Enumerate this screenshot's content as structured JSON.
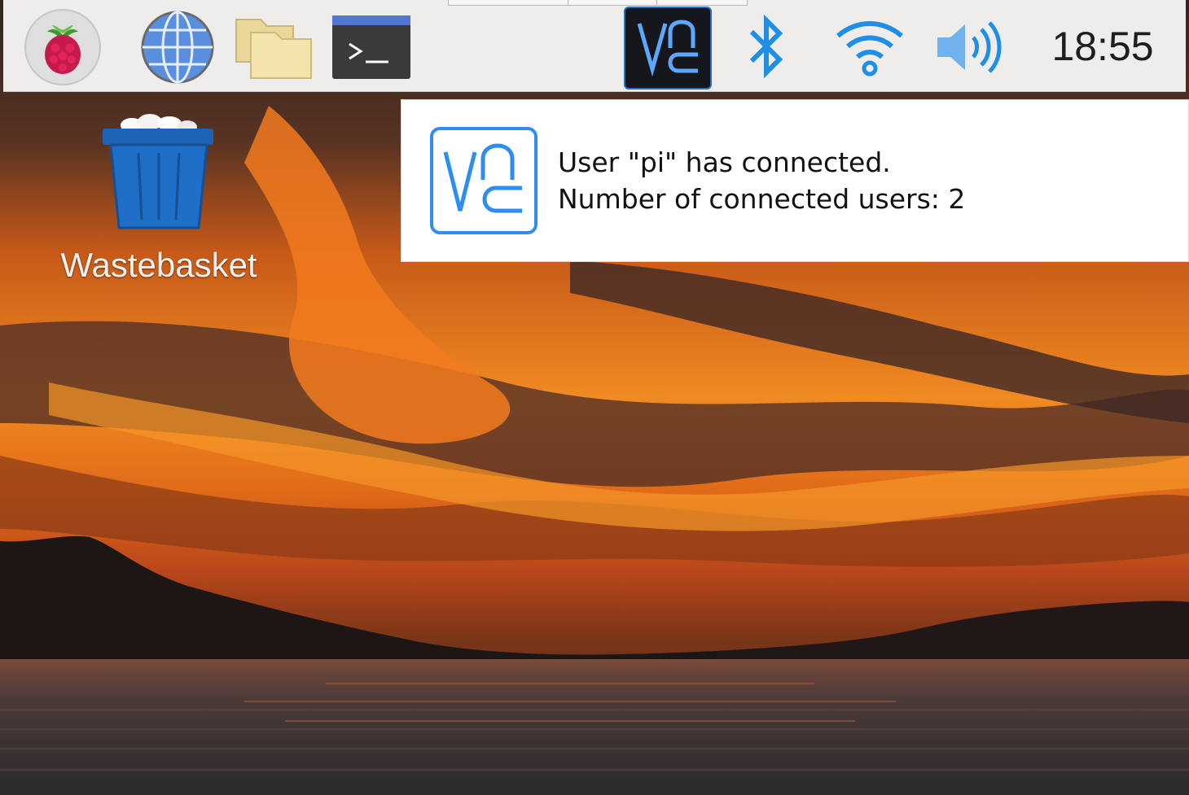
{
  "taskbar": {
    "launchers": [
      {
        "name": "raspberry-pi-menu",
        "icon": "raspberry-icon"
      },
      {
        "name": "web-browser",
        "icon": "globe-icon"
      },
      {
        "name": "file-manager",
        "icon": "folder-icon"
      },
      {
        "name": "terminal",
        "icon": "terminal-icon",
        "glyph": ">_"
      }
    ],
    "tray": [
      {
        "name": "vnc-server",
        "icon": "vnc-icon",
        "active": true
      },
      {
        "name": "bluetooth",
        "icon": "bluetooth-icon"
      },
      {
        "name": "wifi",
        "icon": "wifi-icon"
      },
      {
        "name": "volume",
        "icon": "volume-icon"
      }
    ],
    "clock": "18:55"
  },
  "desktop": {
    "icons": [
      {
        "label": "Wastebasket",
        "icon": "trash-icon"
      }
    ]
  },
  "notification": {
    "icon": "vnc-icon",
    "line1": "User \"pi\" has connected.",
    "line2": "Number of connected users: 2"
  },
  "colors": {
    "panel_bg": "#eeedec",
    "accent_blue": "#1e8ee6",
    "vnc_blue": "#2a6fc7",
    "notification_bg": "#ffffff"
  }
}
